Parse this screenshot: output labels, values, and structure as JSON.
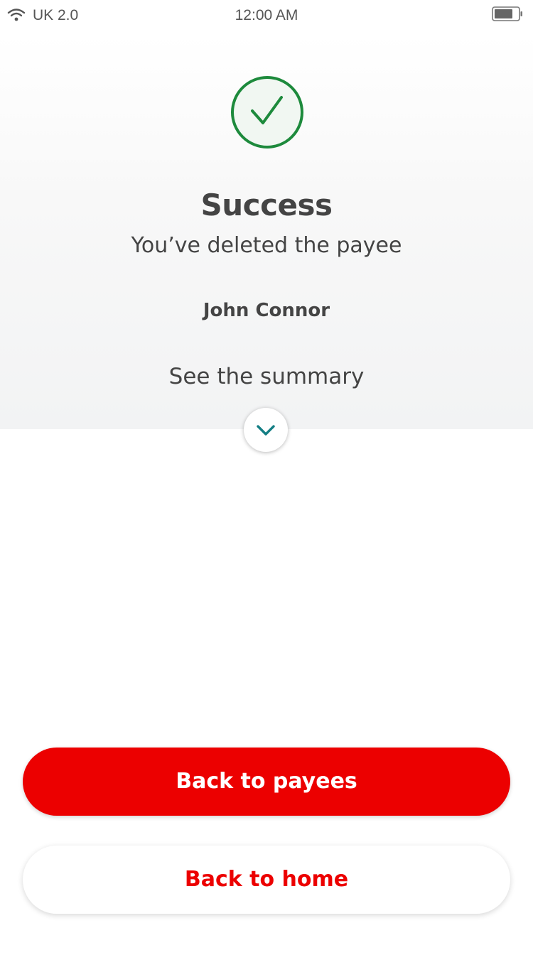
{
  "status_bar": {
    "carrier": "UK 2.0",
    "time": "12:00 AM",
    "wifi_icon": "wifi-icon",
    "battery_icon": "battery-icon"
  },
  "confirmation": {
    "icon": "checkmark-circle-icon",
    "title": "Success",
    "message": "You’ve deleted the payee",
    "payee_name": "John Connor",
    "summary_link": "See the summary",
    "expand_icon": "chevron-down-icon"
  },
  "actions": {
    "primary_label": "Back to payees",
    "secondary_label": "Back to home"
  },
  "colors": {
    "brand_red": "#ec0000",
    "success_green": "#1d8a3c",
    "chevron_teal": "#137e84",
    "text": "#444444"
  }
}
